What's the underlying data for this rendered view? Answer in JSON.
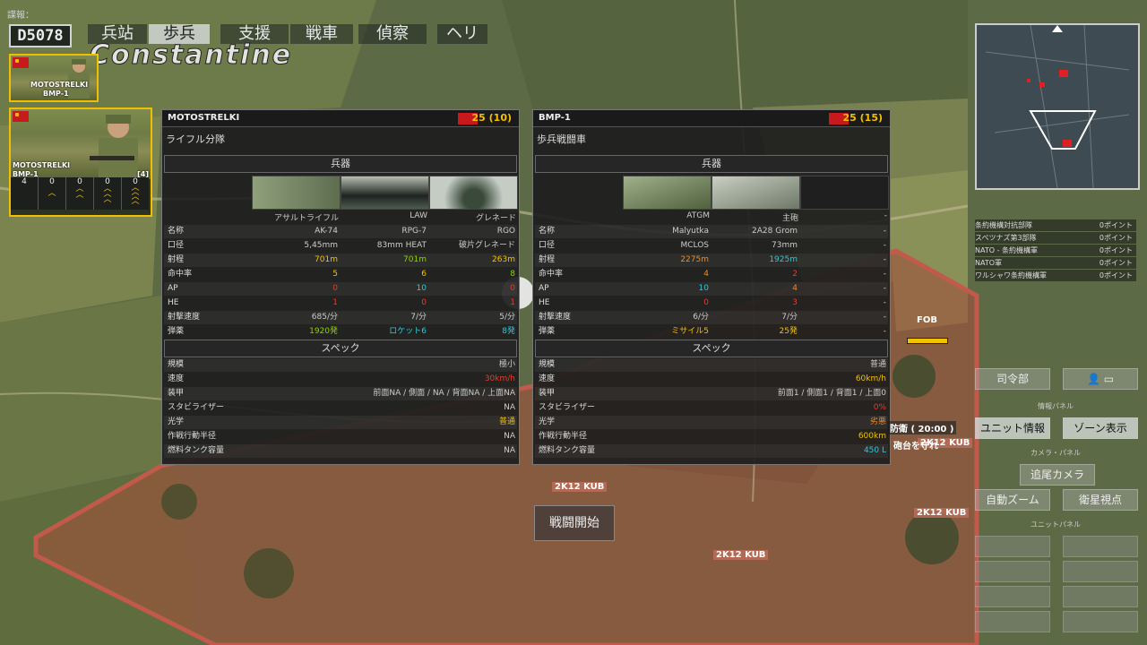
{
  "top": {
    "intel_label": "諜報：",
    "money": "D5078",
    "tabs": [
      {
        "label": "兵站",
        "active": false
      },
      {
        "label": "歩兵",
        "active": true
      },
      {
        "label": "支援",
        "active": false
      },
      {
        "label": "戦車",
        "active": false
      },
      {
        "label": "偵察",
        "active": false
      },
      {
        "label": "ヘリ",
        "active": false
      }
    ],
    "map_name": "Constantine"
  },
  "cards": [
    {
      "line1": "MOTOSTRELKI",
      "line2": "BMP-1"
    },
    {
      "line1": "MOTOSTRELKI",
      "line2": "BMP-1",
      "count": "[4]",
      "veterancy": [
        "4",
        "0",
        "0",
        "0",
        "0"
      ]
    }
  ],
  "panels": [
    {
      "name": "MOTOSTRELKI",
      "cost": "25 (10)",
      "subtitle": "ライフル分隊",
      "weapons_header": "兵器",
      "weapon_names": [
        "アサルトライフル",
        "LAW",
        "グレネード"
      ],
      "rows": [
        {
          "label": "名称",
          "values": [
            "AK-74",
            "RPG-7",
            "RGO"
          ],
          "colors": [
            "",
            "",
            ""
          ]
        },
        {
          "label": "口径",
          "values": [
            "5,45mm",
            "83mm HEAT",
            "破片グレネード"
          ],
          "colors": [
            "",
            "",
            ""
          ]
        },
        {
          "label": "射程",
          "values": [
            "701m",
            "701m",
            "263m"
          ],
          "colors": [
            "y",
            "g",
            "y"
          ]
        },
        {
          "label": "命中率",
          "values": [
            "5",
            "6",
            "8"
          ],
          "colors": [
            "y",
            "y",
            "g"
          ]
        },
        {
          "label": "AP",
          "values": [
            "0",
            "10",
            "0"
          ],
          "colors": [
            "r",
            "c",
            "r"
          ]
        },
        {
          "label": "HE",
          "values": [
            "1",
            "0",
            "1"
          ],
          "colors": [
            "r",
            "r",
            "r"
          ]
        },
        {
          "label": "射撃速度",
          "values": [
            "685/分",
            "7/分",
            "5/分"
          ],
          "colors": [
            "",
            "",
            ""
          ]
        },
        {
          "label": "弾薬",
          "values": [
            "1920発",
            "ロケット6",
            "8発"
          ],
          "colors": [
            "g",
            "c",
            "c"
          ]
        }
      ],
      "spec_header": "スペック",
      "spec": [
        {
          "label": "規模",
          "value": "極小",
          "color": ""
        },
        {
          "label": "速度",
          "value": "30km/h",
          "color": "r"
        },
        {
          "label": "装甲",
          "value": "前面NA / 側面 / NA / 背面NA / 上面NA",
          "color": ""
        },
        {
          "label": "スタビライザー",
          "value": "NA",
          "color": ""
        },
        {
          "label": "光学",
          "value": "普通",
          "color": "y"
        },
        {
          "label": "作戦行動半径",
          "value": "NA",
          "color": ""
        },
        {
          "label": "燃料タンク容量",
          "value": "NA",
          "color": ""
        }
      ]
    },
    {
      "name": "BMP-1",
      "cost": "25 (15)",
      "subtitle": "歩兵戦闘車",
      "weapons_header": "兵器",
      "weapon_names": [
        "ATGM",
        "主砲",
        "-"
      ],
      "rows": [
        {
          "label": "名称",
          "values": [
            "Malyutka",
            "2A28 Grom",
            "-"
          ],
          "colors": [
            "",
            "",
            ""
          ]
        },
        {
          "label": "口径",
          "values": [
            "MCLOS",
            "73mm",
            "-"
          ],
          "colors": [
            "",
            "",
            ""
          ]
        },
        {
          "label": "射程",
          "values": [
            "2275m",
            "1925m",
            "-"
          ],
          "colors": [
            "o",
            "c",
            ""
          ]
        },
        {
          "label": "命中率",
          "values": [
            "4",
            "2",
            "-"
          ],
          "colors": [
            "o",
            "r",
            ""
          ]
        },
        {
          "label": "AP",
          "values": [
            "10",
            "4",
            "-"
          ],
          "colors": [
            "c",
            "o",
            ""
          ]
        },
        {
          "label": "HE",
          "values": [
            "0",
            "3",
            "-"
          ],
          "colors": [
            "r",
            "r",
            ""
          ]
        },
        {
          "label": "射撃速度",
          "values": [
            "6/分",
            "7/分",
            "-"
          ],
          "colors": [
            "",
            "",
            ""
          ]
        },
        {
          "label": "弾薬",
          "values": [
            "ミサイル5",
            "25発",
            "-"
          ],
          "colors": [
            "y",
            "y",
            ""
          ]
        }
      ],
      "spec_header": "スペック",
      "spec": [
        {
          "label": "規模",
          "value": "普通",
          "color": ""
        },
        {
          "label": "速度",
          "value": "60km/h",
          "color": "y"
        },
        {
          "label": "装甲",
          "value": "前面1 / 側面1 / 背面1 / 上面0",
          "color": ""
        },
        {
          "label": "スタビライザー",
          "value": "0%",
          "color": "r"
        },
        {
          "label": "光学",
          "value": "劣悪",
          "color": "o"
        },
        {
          "label": "作戦行動半径",
          "value": "600km",
          "color": "y"
        },
        {
          "label": "燃料タンク容量",
          "value": "450 L",
          "color": "c"
        }
      ]
    }
  ],
  "points": [
    {
      "label": "条約機構対抗部隊",
      "value": "0ポイント"
    },
    {
      "label": "スペツナズ第3部隊",
      "value": "0ポイント"
    },
    {
      "label": "NATO - 条約機構軍",
      "value": "0ポイント"
    },
    {
      "label": "NATO軍",
      "value": "0ポイント"
    },
    {
      "label": "ワルシャワ条約機構軍",
      "value": "0ポイント"
    }
  ],
  "right_panel": {
    "hq": "司令部",
    "info_panel_label": "情報パネル",
    "unit_info": "ユニット情報",
    "zone_view": "ゾーン表示",
    "camera_panel_label": "カメラ・パネル",
    "follow_camera": "追尾カメラ",
    "auto_zoom": "自動ズーム",
    "satellite_view": "衛星視点",
    "unit_panel_label": "ユニットパネル"
  },
  "map_labels": {
    "fob": "FOB",
    "kub1": "2K12 KUB",
    "kub2": "2K12 KUB",
    "kub3": "2K12 KUB",
    "kub4": "2K12 KUB",
    "objective": "防衛 ( 20:00 )",
    "objective_sub": "砲台を守れ"
  },
  "battle_button": "戦闘開始",
  "colors": {
    "accent": "#f2c100",
    "soviet_red": "#c8191c",
    "zone_red": "#b34a3a"
  }
}
